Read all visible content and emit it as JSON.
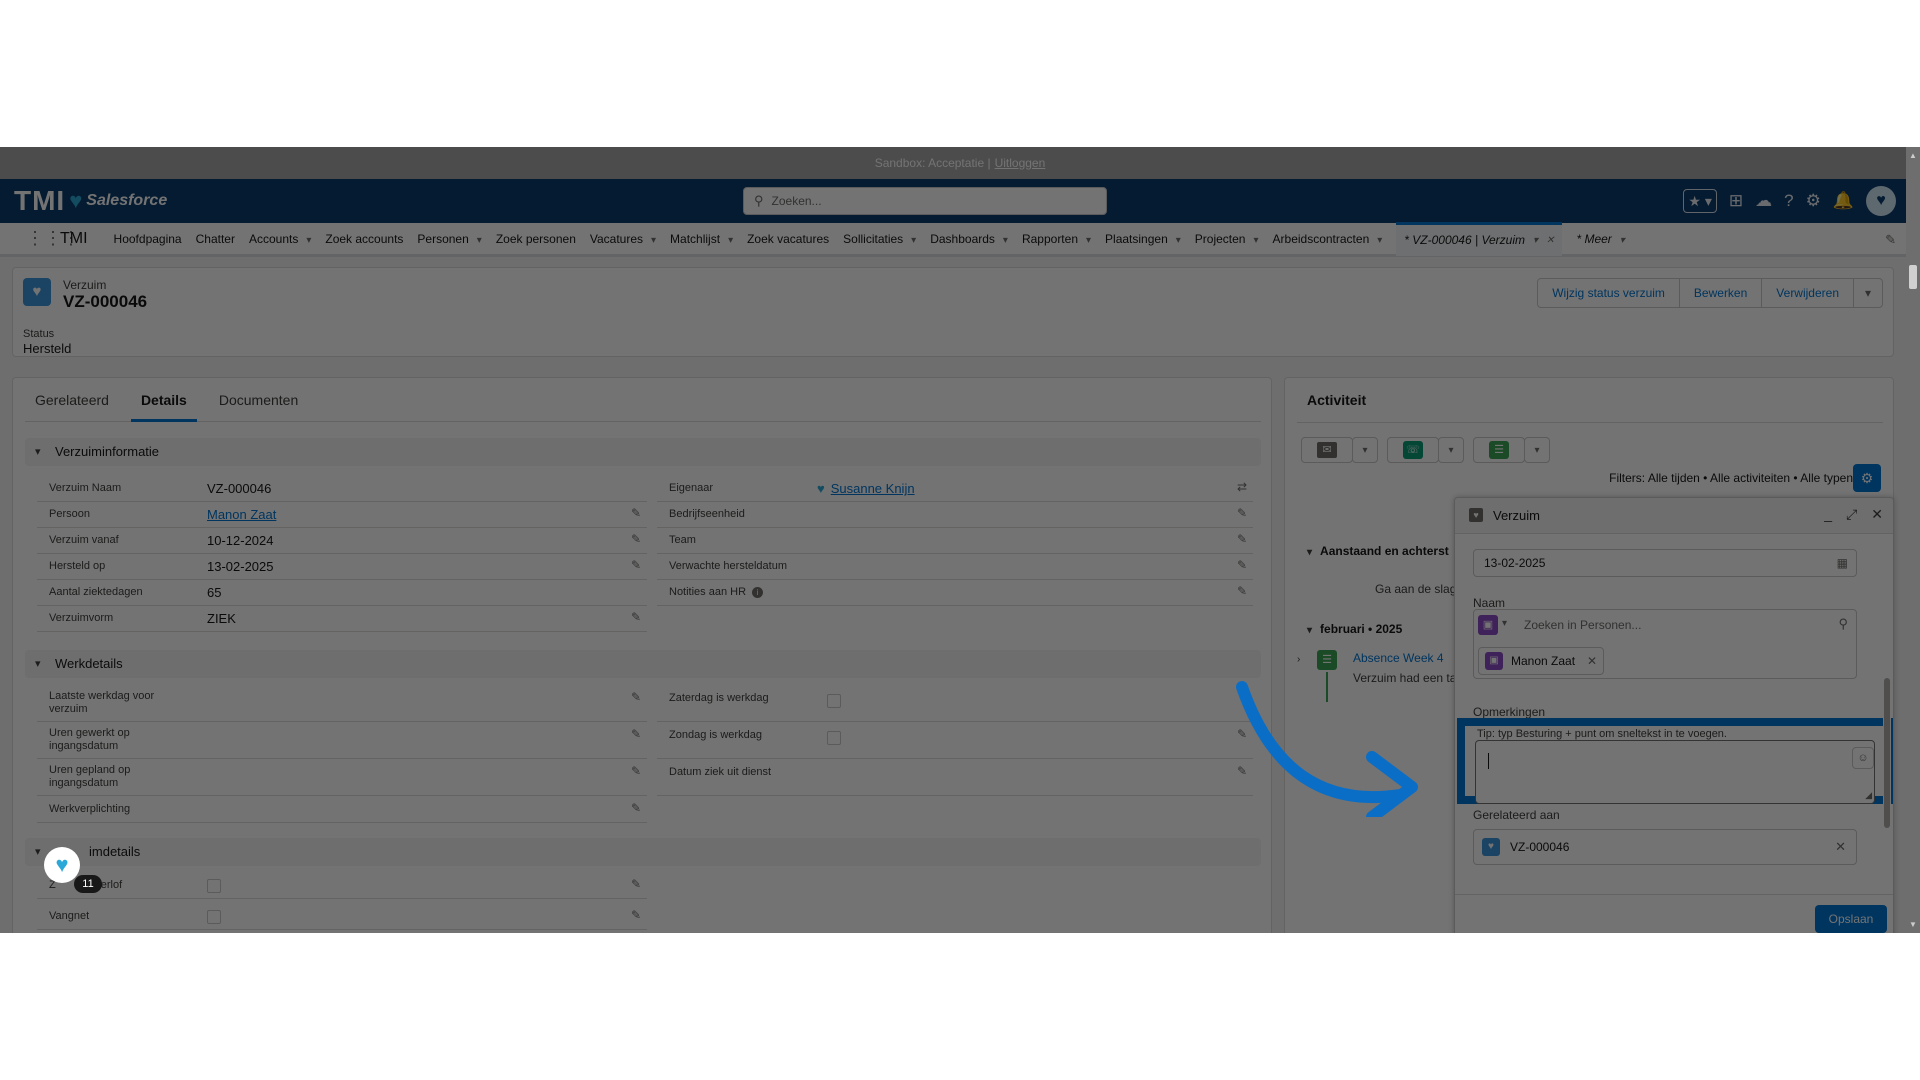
{
  "sandbox": {
    "text": "Sandbox: Acceptatie |",
    "logout": "Uitloggen"
  },
  "header": {
    "logo_tmi": "TMI",
    "logo_sf": "Salesforce",
    "search_placeholder": "Zoeken...",
    "icons": [
      "favorites-icon",
      "add-icon",
      "trailhead-icon",
      "help-icon",
      "settings-icon",
      "notifications-icon",
      "avatar"
    ]
  },
  "nav": {
    "app": "TMI",
    "items": [
      {
        "label": "Hoofdpagina",
        "dropdown": false
      },
      {
        "label": "Chatter",
        "dropdown": false
      },
      {
        "label": "Accounts",
        "dropdown": true
      },
      {
        "label": "Zoek accounts",
        "dropdown": false
      },
      {
        "label": "Personen",
        "dropdown": true
      },
      {
        "label": "Zoek personen",
        "dropdown": false
      },
      {
        "label": "Vacatures",
        "dropdown": true
      },
      {
        "label": "Matchlijst",
        "dropdown": true
      },
      {
        "label": "Zoek vacatures",
        "dropdown": false
      },
      {
        "label": "Sollicitaties",
        "dropdown": true
      },
      {
        "label": "Dashboards",
        "dropdown": true
      },
      {
        "label": "Rapporten",
        "dropdown": true
      },
      {
        "label": "Plaatsingen",
        "dropdown": true
      },
      {
        "label": "Projecten",
        "dropdown": true
      },
      {
        "label": "Arbeidscontracten",
        "dropdown": true
      }
    ],
    "active_tab": "* VZ-000046 | Verzuim",
    "more": "* Meer"
  },
  "record": {
    "type": "Verzuim",
    "title": "VZ-000046",
    "status_label": "Status",
    "status_value": "Hersteld",
    "buttons": [
      "Wijzig status verzuim",
      "Bewerken",
      "Verwijderen"
    ]
  },
  "tabs": [
    "Gerelateerd",
    "Details",
    "Documenten"
  ],
  "sections": {
    "s1": "Verzuiminformatie",
    "s2": "Werkdetails",
    "s3": "imdetails"
  },
  "fields_left1": [
    {
      "label": "Verzuim Naam",
      "value": "VZ-000046"
    },
    {
      "label": "Persoon",
      "value": "Manon Zaat"
    },
    {
      "label": "Verzuim vanaf",
      "value": "10-12-2024"
    },
    {
      "label": "Hersteld op",
      "value": "13-02-2025"
    },
    {
      "label": "Aantal ziektedagen",
      "value": "65"
    },
    {
      "label": "Verzuimvorm",
      "value": "ZIEK"
    }
  ],
  "fields_right1": [
    {
      "label": "Eigenaar",
      "value": "Susanne Knijn"
    },
    {
      "label": "Bedrijfseenheid",
      "value": ""
    },
    {
      "label": "Team",
      "value": ""
    },
    {
      "label": "Verwachte hersteldatum",
      "value": ""
    },
    {
      "label": "Notities aan HR",
      "value": ""
    }
  ],
  "fields_left2": [
    {
      "label": "Laatste werkdag voor verzuim"
    },
    {
      "label": "Uren gewerkt op ingangsdatum"
    },
    {
      "label": "Uren gepland op ingangsdatum"
    },
    {
      "label": "Werkverplichting"
    }
  ],
  "fields_right2": [
    {
      "label": "Zaterdag is werkdag"
    },
    {
      "label": "Zondag is werkdag"
    },
    {
      "label": "Datum ziek uit dienst"
    }
  ],
  "fields_left3": [
    {
      "label": "Z",
      "label2": "sverlof"
    },
    {
      "label": "Vangnet"
    }
  ],
  "activity": {
    "title": "Activiteit",
    "filters": "Filters: Alle tijden • Alle activiteiten • Alle typen",
    "upcoming": "Aanstaand en achterst",
    "upcoming_text": "Ga aan de slag",
    "month": "februari • 2025",
    "item_title": "Absence Week 4",
    "item_text": "Verzuim had een ta"
  },
  "composer": {
    "title": "Verzuim",
    "date": "13-02-2025",
    "naam_label": "Naam",
    "naam_placeholder": "Zoeken in Personen...",
    "naam_pill": "Manon Zaat",
    "opm_label": "Opmerkingen",
    "hint": "Tip: typ Besturing + punt om sneltekst in te voegen.",
    "related_label": "Gerelateerd aan",
    "related_value": "VZ-000046",
    "save": "Opslaan"
  },
  "helper": {
    "badge": "11"
  },
  "colors": {
    "header": "#0b3d6e",
    "brand": "#0176d3",
    "highlight": "#0176d3"
  }
}
